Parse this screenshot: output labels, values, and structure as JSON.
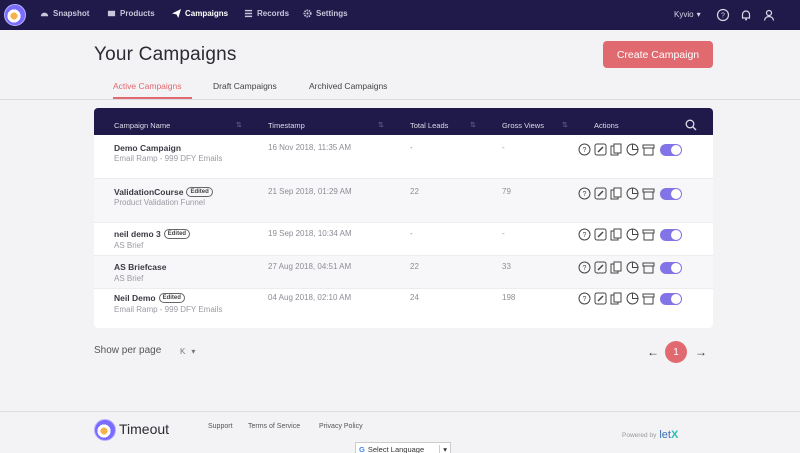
{
  "nav": {
    "items": [
      {
        "label": "Snapshot",
        "icon": "gauge-icon"
      },
      {
        "label": "Products",
        "icon": "box-icon"
      },
      {
        "label": "Campaigns",
        "icon": "paper-plane-icon"
      },
      {
        "label": "Records",
        "icon": "list-icon"
      },
      {
        "label": "Settings",
        "icon": "gear-icon"
      }
    ],
    "user": "Kyvio"
  },
  "header": {
    "title": "Your Campaigns",
    "create_label": "Create Campaign"
  },
  "tabs": [
    "Active Campaigns",
    "Draft Campaigns",
    "Archived Campaigns"
  ],
  "table": {
    "columns": [
      "Campaign Name",
      "Timestamp",
      "Total Leads",
      "Gross Views",
      "Actions"
    ],
    "rows": [
      {
        "name": "Demo Campaign",
        "badge": "",
        "sub": "Email Ramp - 999 DFY Emails",
        "timestamp": "16 Nov 2018, 11:35 AM",
        "leads": "-",
        "views": "-"
      },
      {
        "name": "ValidationCourse",
        "badge": "Edited",
        "sub": "Product Validation Funnel",
        "timestamp": "21 Sep 2018, 01:29 AM",
        "leads": "22",
        "views": "79"
      },
      {
        "name": "neil demo 3",
        "badge": "Edited",
        "sub": "AS Brief",
        "timestamp": "19 Sep 2018, 10:34 AM",
        "leads": "-",
        "views": "-"
      },
      {
        "name": "AS Briefcase",
        "badge": "",
        "sub": "AS Brief",
        "timestamp": "27 Aug 2018, 04:51 AM",
        "leads": "22",
        "views": "33"
      },
      {
        "name": "Neil Demo",
        "badge": "Edited",
        "sub": "Email Ramp - 999 DFY Emails",
        "timestamp": "04 Aug 2018, 02:10 AM",
        "leads": "24",
        "views": "198"
      }
    ]
  },
  "pager": {
    "show_label": "Show per page",
    "per_value": "K",
    "current_page": "1"
  },
  "footer": {
    "brand": "Timeout",
    "links": [
      "Support",
      "Terms of Service",
      "Privacy Policy"
    ],
    "powered": "Powered by",
    "powered_brand": "let",
    "powered_brand_x": "X",
    "language": "Select Language"
  },
  "colors": {
    "nav_bg": "#1f1a4a",
    "accent": "#e06a6f",
    "toggle": "#8273e6"
  }
}
